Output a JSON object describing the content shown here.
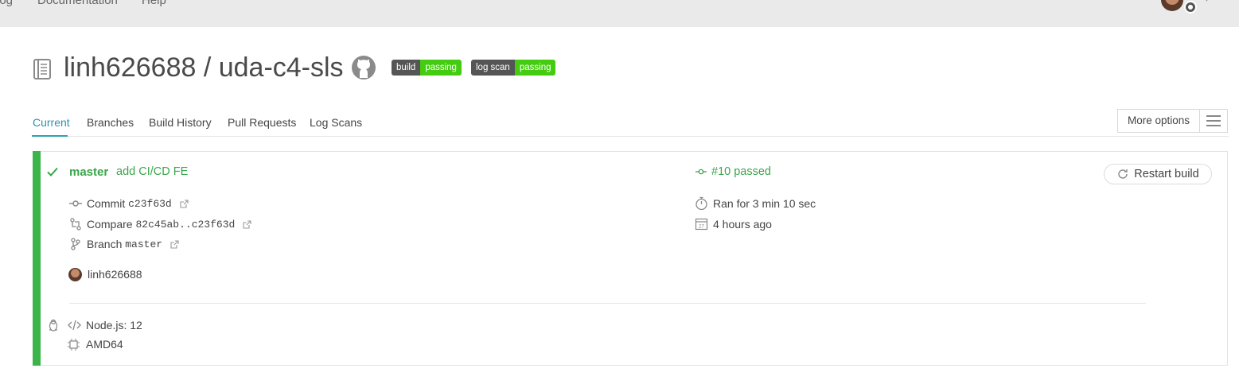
{
  "topnav": {
    "items": [
      "log",
      "Documentation",
      "Help"
    ]
  },
  "repo": {
    "owner_repo": "linh626688 / uda-c4-sls"
  },
  "badges": [
    {
      "key": "build",
      "value": "passing"
    },
    {
      "key": "log scan",
      "value": "passing"
    }
  ],
  "tabs": [
    {
      "label": "Current",
      "active": true
    },
    {
      "label": "Branches"
    },
    {
      "label": "Build History"
    },
    {
      "label": "Pull Requests"
    },
    {
      "label": "Log Scans"
    }
  ],
  "more_options": {
    "label": "More options"
  },
  "build": {
    "branch": "master",
    "message": "add CI/CD FE",
    "commit_label": "Commit",
    "commit_hash": "c23f63d",
    "compare_label": "Compare",
    "compare_range": "82c45ab..c23f63d",
    "branch_label": "Branch",
    "branch_value": "master",
    "author": "linh626688",
    "number_status": "#10 passed",
    "duration": "Ran for 3 min 10 sec",
    "finished": "4 hours ago",
    "restart_label": "Restart build",
    "language": "Node.js: 12",
    "arch": "AMD64"
  },
  "colors": {
    "passed": "#3aa54a",
    "accent": "#2f8fb0",
    "badge_green": "#44cc11"
  },
  "icons": [
    "repo-icon",
    "github-icon",
    "check-icon",
    "commit-icon",
    "compare-icon",
    "branch-icon",
    "external-link-icon",
    "stopwatch-icon",
    "calendar-icon",
    "restart-icon",
    "linux-icon",
    "code-icon",
    "cpu-icon",
    "hamburger-icon"
  ]
}
